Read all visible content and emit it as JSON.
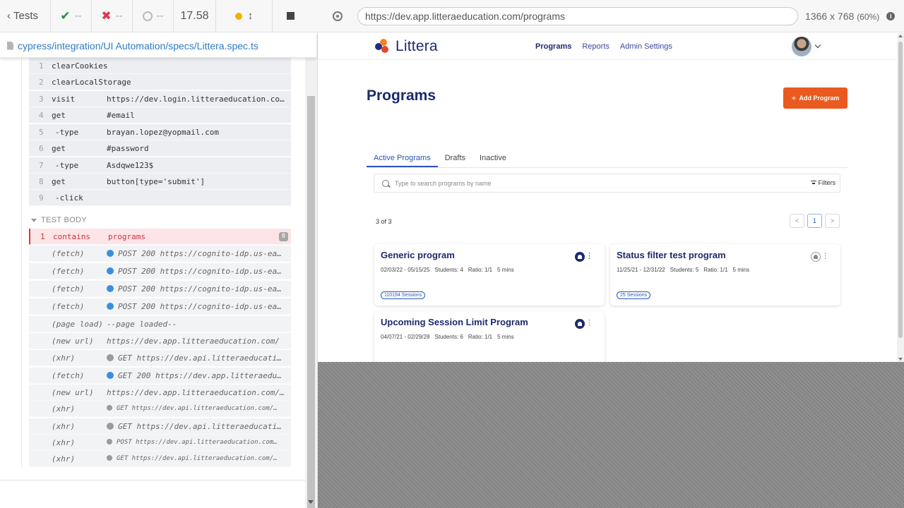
{
  "reporter": {
    "tests_label": "Tests",
    "passed": "--",
    "failed": "--",
    "pending": "--",
    "duration": "17.58",
    "spec_path": "cypress/integration/UI Automation/specs/Littera.spec.ts",
    "test_body_label": "TEST BODY",
    "before_commands": [
      {
        "num": "1",
        "name": "clearCookies",
        "msg": ""
      },
      {
        "num": "2",
        "name": "clearLocalStorage",
        "msg": ""
      },
      {
        "num": "3",
        "name": "visit",
        "msg": "https://dev.login.litteraeducation.co…"
      },
      {
        "num": "4",
        "name": "get",
        "msg": "#email"
      },
      {
        "num": "5",
        "name": "-type",
        "msg": "brayan.lopez@yopmail.com"
      },
      {
        "num": "6",
        "name": "get",
        "msg": "#password"
      },
      {
        "num": "7",
        "name": "-type",
        "msg": "Asdqwe123$"
      },
      {
        "num": "8",
        "name": "get",
        "msg": "button[type='submit']"
      },
      {
        "num": "9",
        "name": "-click",
        "msg": ""
      }
    ],
    "body_commands": [
      {
        "num": "1",
        "name": "contains",
        "msg": "programs",
        "badge": "0"
      },
      {
        "name": "(fetch)",
        "msg": "POST 200 https://cognito-idp.us-ea…"
      },
      {
        "name": "(fetch)",
        "msg": "POST 200 https://cognito-idp.us-ea…"
      },
      {
        "name": "(fetch)",
        "msg": "POST 200 https://cognito-idp.us-ea…"
      },
      {
        "name": "(fetch)",
        "msg": "POST 200 https://cognito-idp.us-ea…"
      },
      {
        "name": "(page load)",
        "msg": "--page loaded--"
      },
      {
        "name": "(new url)",
        "msg": "https://dev.app.litteraeducation.com/"
      },
      {
        "name": "(xhr)",
        "msg": "GET https://dev.api.litteraeducati…"
      },
      {
        "name": "(fetch)",
        "msg": "GET 200 https://dev.app.litteraedu…"
      },
      {
        "name": "(new url)",
        "msg": "https://dev.app.litteraeducation.com/…"
      },
      {
        "name": "(xhr)",
        "msg": "GET https://dev.api.litteraeducation.com/…"
      },
      {
        "name": "(xhr)",
        "msg": "GET https://dev.api.litteraeducati…"
      },
      {
        "name": "(xhr)",
        "msg": "POST https://dev.api.litteraeducation.com…"
      },
      {
        "name": "(xhr)",
        "msg": "GET https://dev.api.litteraeducation.com/…"
      }
    ]
  },
  "aut": {
    "url": "https://dev.app.litteraeducation.com/programs",
    "viewport": "1366 x 768",
    "scale": "(60%)"
  },
  "app": {
    "logo_text": "Littera",
    "nav": [
      "Programs",
      "Reports",
      "Admin Settings"
    ],
    "page_title": "Programs",
    "add_button": "Add Program",
    "tabs": [
      "Active Programs",
      "Drafts",
      "Inactive"
    ],
    "search_placeholder": "Type to search programs by name",
    "filters_label": "Filters",
    "count_text": "3 of 3",
    "pager": {
      "prev": "<",
      "current": "1",
      "next": ">"
    },
    "programs": [
      {
        "title": "Generic program",
        "dates": "02/03/22 - 05/15/25",
        "students": "Students: 4",
        "ratio": "Ratio: 1/1",
        "duration": "5 mins",
        "sessions": "110194 Sessions"
      },
      {
        "title": "Status filter test program",
        "dates": "11/25/21 - 12/31/22",
        "students": "Students: 5",
        "ratio": "Ratio: 1/1",
        "duration": "5 mins",
        "sessions": "25 Sessions"
      },
      {
        "title": "Upcoming Session Limit Program",
        "dates": "04/07/21 - 02/29/28",
        "students": "Students: 6",
        "ratio": "Ratio: 1/1",
        "duration": "5 mins",
        "sessions": ""
      }
    ]
  },
  "colors": {
    "accent": "#ea5a1e",
    "brand": "#1d2a6e",
    "link": "#2b56b6",
    "fail": "#e0383e",
    "pass": "#1a8f3d"
  }
}
